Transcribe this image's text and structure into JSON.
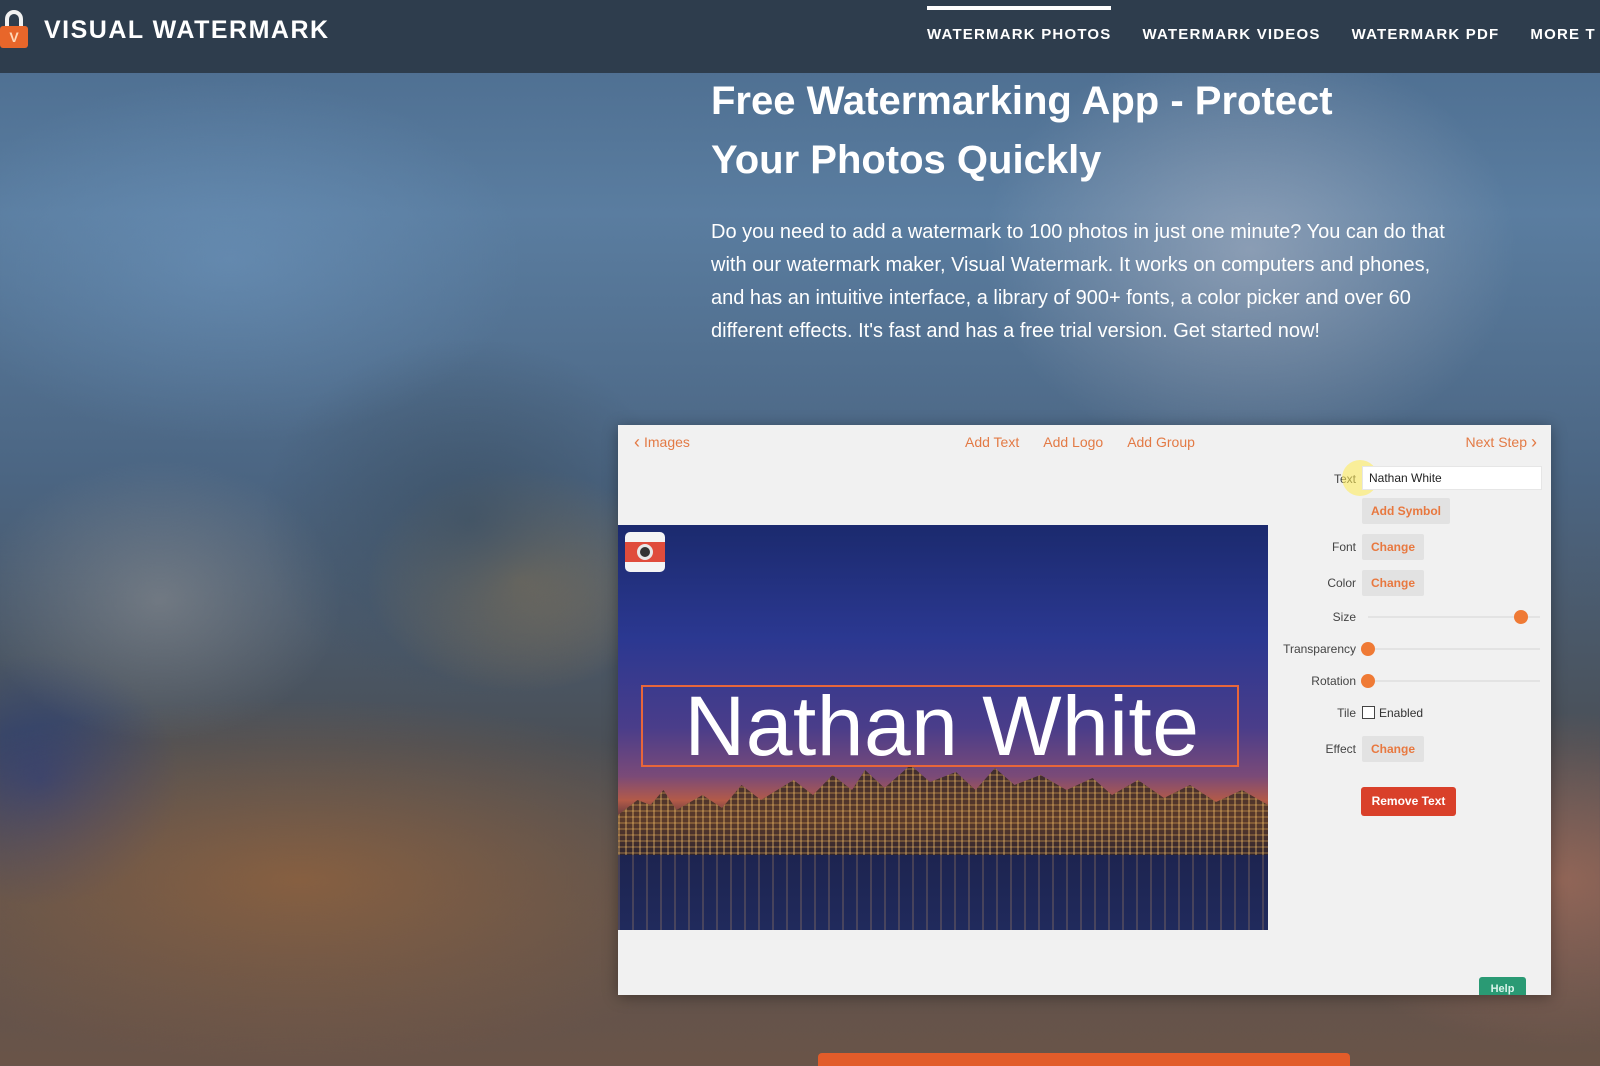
{
  "header": {
    "brand": "VISUAL WATERMARK",
    "logo_letter": "V",
    "nav": [
      {
        "label": "WATERMARK PHOTOS",
        "active": true
      },
      {
        "label": "WATERMARK VIDEOS",
        "active": false
      },
      {
        "label": "WATERMARK PDF",
        "active": false
      },
      {
        "label": "MORE T",
        "active": false
      }
    ]
  },
  "hero": {
    "title": "Free Watermarking App - Protect Your Photos Quickly",
    "description": "Do you need to add a watermark to 100 photos in just one minute? You can do that with our watermark maker, Visual Watermark. It works on computers and phones, and has an intuitive interface, a library of 900+ fonts, a color picker and over 60 different effects. It's fast and has a free trial version. Get started now!"
  },
  "app": {
    "back_label": "Images",
    "tabs": [
      "Add Text",
      "Add Logo",
      "Add Group"
    ],
    "next_label": "Next Step",
    "watermark_text": "Nathan White",
    "panel": {
      "text_label": "Text",
      "text_value": "Nathan White",
      "add_symbol": "Add Symbol",
      "font_label": "Font",
      "color_label": "Color",
      "change_label": "Change",
      "size_label": "Size",
      "size_level": 0.93,
      "transparency_label": "Transparency",
      "transparency_level": 0.0,
      "rotation_label": "Rotation",
      "rotation_level": 0.0,
      "tile_label": "Tile",
      "tile_checkbox_label": "Enabled",
      "tile_enabled": false,
      "effect_label": "Effect",
      "remove_text": "Remove Text"
    },
    "help_label": "Help"
  },
  "colors": {
    "accent": "#e8783f",
    "remove": "#d9402a",
    "help": "#2a9a74",
    "topbar": "#2e3d4d"
  },
  "icons": {
    "logo": "lock-icon",
    "photo_badge": "camera-icon",
    "back": "chevron-left-icon",
    "next": "chevron-right-icon"
  }
}
